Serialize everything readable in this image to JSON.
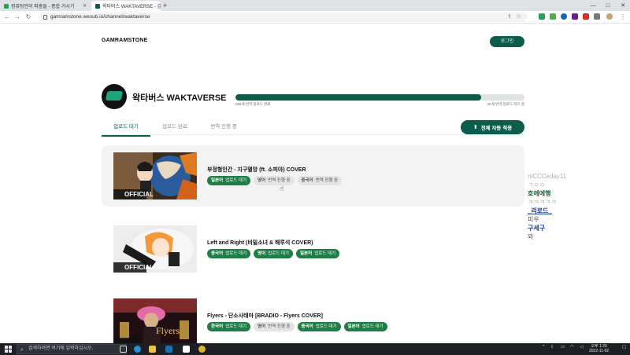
{
  "browser": {
    "tabs": [
      {
        "title": "컴퓨팅언어 파충돌 - 종합 거시기"
      },
      {
        "title": "왁타버스 WAKTAVERSE - 감람스"
      }
    ],
    "new_tab": "+",
    "url": "gamramstone.wesub.io/channel/waktaverse",
    "window_controls": {
      "minimize": "—",
      "maximize": "□",
      "close": "✕"
    }
  },
  "page": {
    "brand": "GAMRAMSTONE",
    "login_label": "로그인",
    "channel": {
      "name": "왁타버스 WAKTAVERSE",
      "progress": 0.85,
      "done_label": "205개 번역 업로드 완료",
      "pending_label": "40개 번역 업로드 대기 중"
    },
    "tabs": [
      {
        "label": "업로드 대기"
      },
      {
        "label": "업로드 완료"
      },
      {
        "label": "번역 진행 중"
      }
    ],
    "auto_apply_label": "전체 자동 적용",
    "videos": [
      {
        "title": "부정형인간 - 지구멸망 (ft. 소피아) COVER",
        "chips": [
          {
            "lang": "일본어",
            "status": "업로드 대기"
          },
          {
            "lang": "영어",
            "status": "번역 진행 중"
          },
          {
            "lang": "중국어",
            "status": "번역 진행 중"
          }
        ],
        "thumb_text": "OFFICIAL"
      },
      {
        "title": "Left and Right (비밀소녀 & 해루석 COVER)",
        "chips": [
          {
            "lang": "중국어",
            "status": "업로드 대기"
          },
          {
            "lang": "영어",
            "status": "업로드 대기"
          },
          {
            "lang": "일본어",
            "status": "업로드 대기"
          }
        ],
        "thumb_text": "OFFICIAL"
      },
      {
        "title": "Flyers - 단소사태마 [BRADIO - Flyers COVER]",
        "chips": [
          {
            "lang": "한국어",
            "status": "업로드 대기"
          },
          {
            "lang": "영어",
            "status": "번역 진행 중"
          },
          {
            "lang": "중국어",
            "status": "업로드 대기"
          },
          {
            "lang": "일본어",
            "status": "업로드 대기"
          }
        ],
        "thumb_text": "Flyers"
      }
    ]
  },
  "overlay_chat": [
    "niCCCeday11",
    "ㄱㅇㅇ",
    "호에에행",
    "ㅋㅋㅋㅋㅋ",
    "_리로드_",
    "피우",
    "구세구",
    "와"
  ],
  "taskbar": {
    "search_placeholder": "검색하려면 여기에 입력하십시오.",
    "time": "오후 1:20",
    "date": "2022-11-02"
  },
  "colors": {
    "brand_green": "#0b5c4a",
    "chip_green": "#1e7e46",
    "chip_gray": "#e4e4e4"
  }
}
